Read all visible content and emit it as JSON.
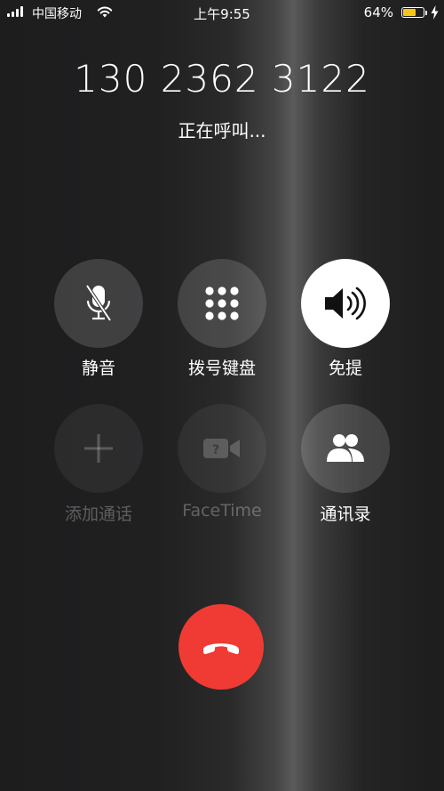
{
  "status_bar": {
    "carrier": "中国移动",
    "time": "上午9:55",
    "battery_percent": "64%",
    "battery_level": 0.64,
    "battery_color": "#f5c518",
    "signal_bars": 4
  },
  "call": {
    "number": "130 2362 3122",
    "status": "正在呼叫..."
  },
  "buttons": {
    "mute": {
      "label": "静音",
      "icon": "microphone-muted-icon"
    },
    "keypad": {
      "label": "拨号键盘",
      "icon": "keypad-icon"
    },
    "speaker": {
      "label": "免提",
      "icon": "speaker-icon"
    },
    "add_call": {
      "label": "添加通话",
      "icon": "plus-icon"
    },
    "facetime": {
      "label": "FaceTime",
      "icon": "video-camera-icon"
    },
    "contacts": {
      "label": "通讯录",
      "icon": "contacts-icon"
    }
  },
  "end_call": {
    "icon": "end-call-icon",
    "color": "#ef3b34"
  }
}
